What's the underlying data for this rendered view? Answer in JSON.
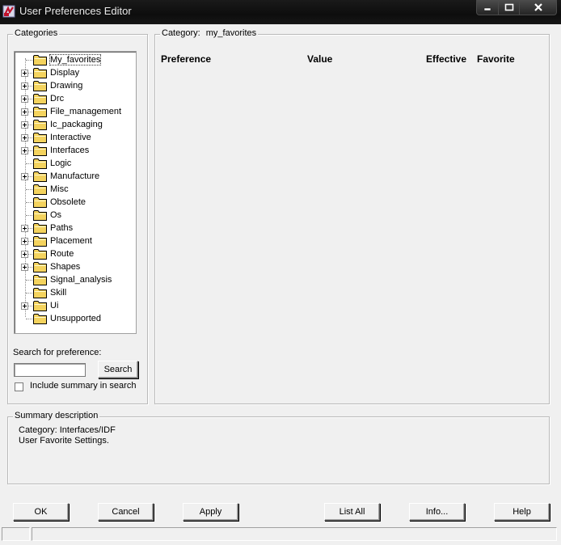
{
  "window": {
    "title": "User Preferences Editor",
    "icon": "app-icon",
    "controls": {
      "minimize": "minimize-icon",
      "maximize": "maximize-icon",
      "close": "close-icon"
    }
  },
  "categories": {
    "legend": "Categories",
    "items": [
      {
        "label": "My_favorites",
        "expandable": false,
        "selected": true
      },
      {
        "label": "Display",
        "expandable": true
      },
      {
        "label": "Drawing",
        "expandable": true
      },
      {
        "label": "Drc",
        "expandable": true
      },
      {
        "label": "File_management",
        "expandable": true
      },
      {
        "label": "Ic_packaging",
        "expandable": true
      },
      {
        "label": "Interactive",
        "expandable": true
      },
      {
        "label": "Interfaces",
        "expandable": true
      },
      {
        "label": "Logic",
        "expandable": false
      },
      {
        "label": "Manufacture",
        "expandable": true
      },
      {
        "label": "Misc",
        "expandable": false
      },
      {
        "label": "Obsolete",
        "expandable": false
      },
      {
        "label": "Os",
        "expandable": false
      },
      {
        "label": "Paths",
        "expandable": true
      },
      {
        "label": "Placement",
        "expandable": true
      },
      {
        "label": "Route",
        "expandable": true
      },
      {
        "label": "Shapes",
        "expandable": true
      },
      {
        "label": "Signal_analysis",
        "expandable": false
      },
      {
        "label": "Skill",
        "expandable": false
      },
      {
        "label": "Ui",
        "expandable": true
      },
      {
        "label": "Unsupported",
        "expandable": false
      }
    ]
  },
  "search": {
    "label": "Search for preference:",
    "value": "",
    "button": "Search",
    "include_summary_label": "Include summary in search",
    "include_summary_checked": false
  },
  "category_panel": {
    "legend_prefix": "Category:",
    "legend_value": "my_favorites",
    "columns": [
      "Preference",
      "Value",
      "Effective",
      "Favorite"
    ]
  },
  "summary": {
    "legend": "Summary description",
    "line1": "Category: Interfaces/IDF",
    "line2": "User Favorite Settings."
  },
  "buttons": {
    "ok": "OK",
    "cancel": "Cancel",
    "apply": "Apply",
    "list_all": "List All",
    "info": "Info...",
    "help": "Help"
  },
  "colors": {
    "titlebar": "#111111",
    "folder": "#f4d35e",
    "background": "#f0f0f0"
  }
}
